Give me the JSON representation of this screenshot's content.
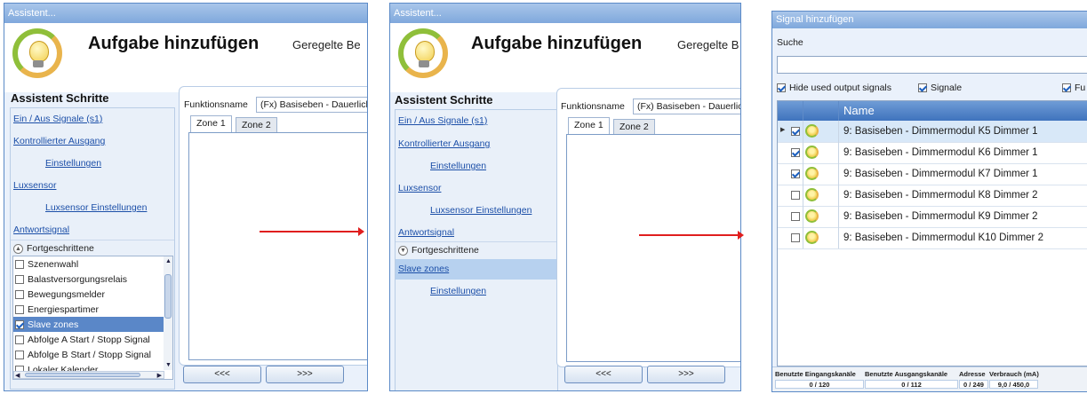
{
  "windows": [
    {
      "title": "Assistent...",
      "header": {
        "title": "Aufgabe hinzufügen",
        "subtitle": "Geregelte Be"
      },
      "steps_title": "Assistent Schritte",
      "steps": [
        {
          "label": "Ein / Aus Signale (s1)"
        },
        {
          "label": "Kontrollierter Ausgang"
        },
        {
          "label": "Einstellungen"
        },
        {
          "label": "Luxsensor"
        },
        {
          "label": "Luxsensor Einstellungen"
        },
        {
          "label": "Antwortsignal"
        }
      ],
      "advanced": {
        "label": "Fortgeschrittene",
        "expanded": true
      },
      "advanced_items": [
        {
          "label": "Szenenwahl",
          "checked": false
        },
        {
          "label": "Balastversorgungsrelais",
          "checked": false
        },
        {
          "label": "Bewegungsmelder",
          "checked": false
        },
        {
          "label": "Energiespartimer",
          "checked": false
        },
        {
          "label": "Slave zones",
          "checked": true,
          "selected": true
        },
        {
          "label": "Abfolge A Start / Stopp Signal",
          "checked": false
        },
        {
          "label": "Abfolge B Start / Stopp Signal",
          "checked": false
        },
        {
          "label": "Lokaler Kalender",
          "checked": false
        }
      ],
      "function_name_label": "Funktionsname",
      "function_name_value": "(Fx) Basiseben - Dauerlich",
      "tabs": [
        {
          "label": "Zone 1",
          "active": true
        },
        {
          "label": "Zone 2",
          "active": false
        }
      ],
      "prev_button": "<<<",
      "next_button": ">>>"
    },
    {
      "title": "Assistent...",
      "header": {
        "title": "Aufgabe hinzufügen",
        "subtitle": "Geregelte B"
      },
      "steps_title": "Assistent Schritte",
      "steps": [
        {
          "label": "Ein / Aus Signale (s1)"
        },
        {
          "label": "Kontrollierter Ausgang"
        },
        {
          "label": "Einstellungen"
        },
        {
          "label": "Luxsensor"
        },
        {
          "label": "Luxsensor Einstellungen"
        },
        {
          "label": "Antwortsignal"
        }
      ],
      "advanced": {
        "label": "Fortgeschrittene",
        "expanded": false
      },
      "extra_steps": [
        {
          "label": "Slave zones"
        },
        {
          "label": "Einstellungen"
        }
      ],
      "function_name_label": "Funktionsname",
      "function_name_value": "(Fx) Basiseben - Dauerlic",
      "tabs": [
        {
          "label": "Zone 1",
          "active": true
        },
        {
          "label": "Zone 2",
          "active": false
        }
      ],
      "prev_button": "<<<",
      "next_button": ">>>"
    }
  ],
  "dialog": {
    "title": "Signal hinzufügen",
    "search_label": "Suche",
    "search_value": "",
    "filters": [
      {
        "label": "Hide used output signals",
        "checked": true
      },
      {
        "label": "Signale",
        "checked": true
      },
      {
        "label": "Fu",
        "checked": true
      }
    ],
    "column_name": "Name",
    "rows": [
      {
        "name": "9: Basiseben - Dimmermodul K5 Dimmer 1",
        "checked": true,
        "selected": true
      },
      {
        "name": "9: Basiseben - Dimmermodul K6 Dimmer 1",
        "checked": true,
        "selected": false
      },
      {
        "name": "9: Basiseben - Dimmermodul K7 Dimmer 1",
        "checked": true,
        "selected": false
      },
      {
        "name": "9: Basiseben - Dimmermodul K8 Dimmer 2",
        "checked": false,
        "selected": false
      },
      {
        "name": "9: Basiseben - Dimmermodul K9 Dimmer 2",
        "checked": false,
        "selected": false
      },
      {
        "name": "9: Basiseben - Dimmermodul K10 Dimmer 2",
        "checked": false,
        "selected": false
      }
    ],
    "status": {
      "input_channels_label": "Benutzte Eingangskanäle",
      "input_channels_value": "0 / 120",
      "output_channels_label": "Benutzte Ausgangskanäle",
      "output_channels_value": "0 / 112",
      "address_label": "Adresse",
      "address_value": "0 / 249",
      "consumption_label": "Verbrauch (mA)",
      "consumption_value": "9,0 / 450,0"
    }
  },
  "colors": {
    "arrow": "#e01e1e",
    "title_bar": "#7fa8dc",
    "selection": "#5a87c8",
    "link": "#1c4fa8"
  }
}
